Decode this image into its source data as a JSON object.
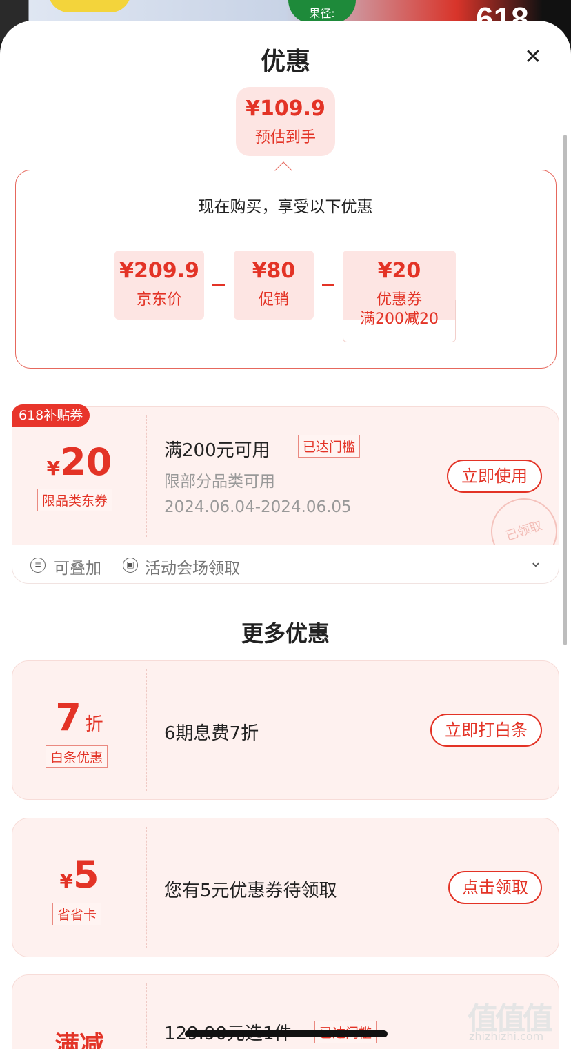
{
  "background": {
    "badge": "果径:",
    "promo": "618"
  },
  "sheet": {
    "title": "优惠",
    "close_icon": "close-icon"
  },
  "estimate": {
    "price": "¥109.9",
    "label": "预估到手"
  },
  "calc": {
    "title": "现在购买，享受以下优惠",
    "items": [
      {
        "value": "¥209.9",
        "label": "京东价"
      },
      {
        "value": "¥80",
        "label": "促销"
      },
      {
        "value": "¥20",
        "label": "优惠券"
      }
    ],
    "coupon_condition": "满200减20"
  },
  "coupon": {
    "corner_tag": "618补贴券",
    "currency": "¥",
    "amount": "20",
    "type_tag": "限品类东券",
    "title": "满200元可用",
    "status_tag": "已达门槛",
    "desc": "限部分品类可用",
    "date_range": "2024.06.04-2024.06.05",
    "button": "立即使用",
    "stamp": "已领取",
    "footer": {
      "stackable": "可叠加",
      "source": "活动会场领取"
    }
  },
  "more": {
    "title": "更多优惠",
    "cards": [
      {
        "value": "7",
        "unit": "折",
        "tag": "白条优惠",
        "text": "6期息费7折",
        "button": "立即打白条"
      },
      {
        "currency": "¥",
        "value": "5",
        "tag": "省省卡",
        "text": "您有5元优惠券待领取",
        "button": "点击领取"
      },
      {
        "value": "满减",
        "text": "129.90元选1件",
        "tag": "已达门槛"
      }
    ]
  },
  "watermark": {
    "text": "值值值",
    "site": "zhizhizhi.com"
  },
  "colors": {
    "accent": "#e33326",
    "chip_bg": "#fde5e3",
    "card_bg": "#fef1ef"
  }
}
